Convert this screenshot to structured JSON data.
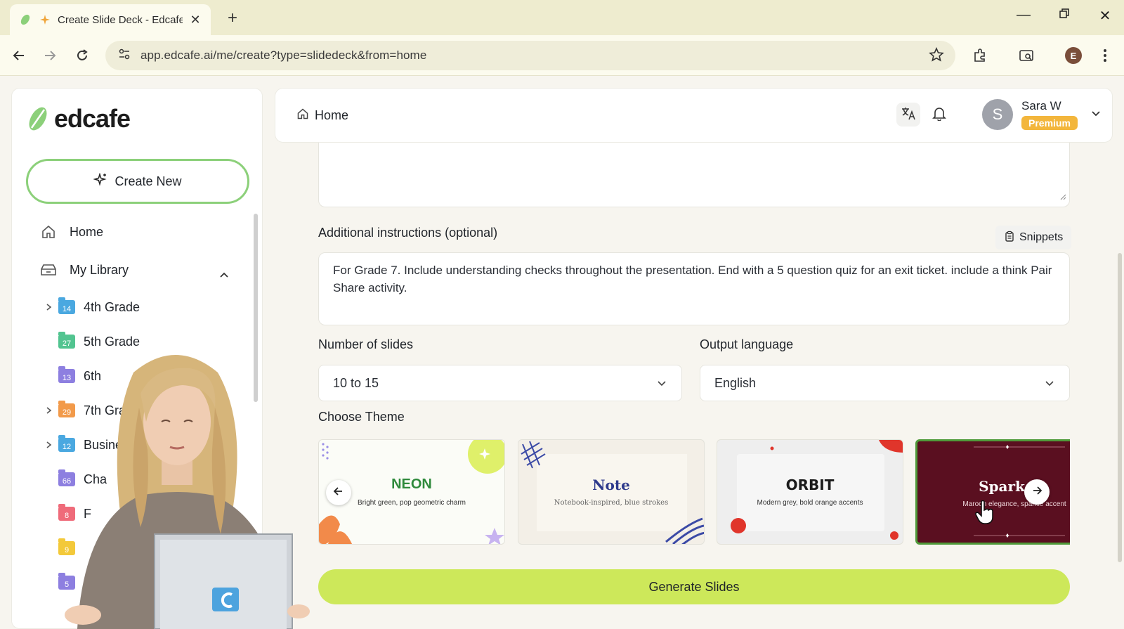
{
  "browser": {
    "tab_title": "Create Slide Deck - Edcafe /",
    "url": "app.edcafe.ai/me/create?type=slidedeck&from=home",
    "profile_initial": "E"
  },
  "sidebar": {
    "logo_text": "edcafe",
    "create_new_label": "Create New",
    "home_label": "Home",
    "library_label": "My Library",
    "folders": [
      {
        "label": "4th Grade",
        "count": "14",
        "color": "#4aa8e0",
        "expandable": true
      },
      {
        "label": "5th Grade",
        "count": "27",
        "color": "#52c490",
        "expandable": false
      },
      {
        "label": "6th",
        "count": "13",
        "color": "#8d7fe0",
        "expandable": false
      },
      {
        "label": "7th Grade",
        "count": "29",
        "color": "#f29a4a",
        "expandable": true
      },
      {
        "label": "Business",
        "count": "12",
        "color": "#4aa8e0",
        "expandable": true
      },
      {
        "label": "Cha",
        "count": "66",
        "color": "#8d7fe0",
        "expandable": false
      },
      {
        "label": "F",
        "count": "8",
        "color": "#ef6b7a",
        "expandable": false
      },
      {
        "label": "",
        "count": "9",
        "color": "#f3c93a",
        "expandable": false
      },
      {
        "label": "",
        "count": "5",
        "color": "#8d7fe0",
        "expandable": false
      }
    ]
  },
  "header": {
    "breadcrumb": "Home",
    "user_name": "Sara W",
    "user_initial": "S",
    "plan_badge": "Premium"
  },
  "form": {
    "instructions_label": "Additional instructions (optional)",
    "snippets_label": "Snippets",
    "instructions_value": "For Grade 7. Include understanding checks throughout the presentation. End with a 5 question quiz for an exit ticket. include a think Pair Share activity.",
    "slides_label": "Number of slides",
    "slides_value": "10 to 15",
    "language_label": "Output language",
    "language_value": "English",
    "theme_label": "Choose Theme",
    "themes": [
      {
        "name": "NEON",
        "desc": "Bright green, pop geometric charm"
      },
      {
        "name": "Note",
        "desc": "Notebook-inspired, blue strokes"
      },
      {
        "name": "ORBIT",
        "desc": "Modern grey, bold orange accents"
      },
      {
        "name": "Spark",
        "desc": "Maroon elegance, sparkle accent"
      }
    ],
    "generate_label": "Generate Slides"
  }
}
